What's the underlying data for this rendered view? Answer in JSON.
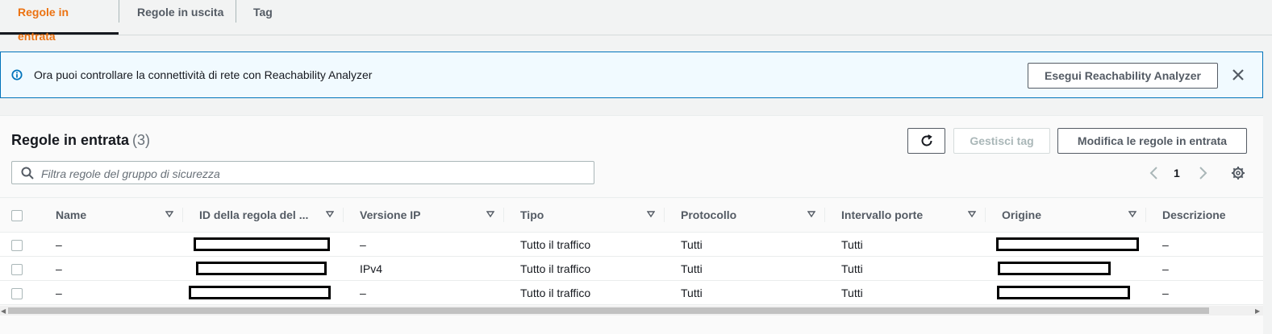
{
  "tabs": [
    {
      "label": "Regole in entrata",
      "active": true
    },
    {
      "label": "Regole in uscita",
      "active": false
    },
    {
      "label": "Tag",
      "active": false
    }
  ],
  "banner": {
    "icon": "info-icon",
    "text": "Ora puoi controllare la connettività di rete con Reachability Analyzer",
    "button_label": "Esegui Reachability Analyzer",
    "close_icon": "close-icon"
  },
  "panel": {
    "title": "Regole in entrata",
    "count": "(3)",
    "refresh_icon": "refresh-icon",
    "manage_tags_label": "Gestisci tag",
    "edit_rules_label": "Modifica le regole in entrata",
    "search_placeholder": "Filtra regole del gruppo di sicurezza",
    "page": "1"
  },
  "table": {
    "columns": [
      "Name",
      "ID della regola del ...",
      "Versione IP",
      "Tipo",
      "Protocollo",
      "Intervallo porte",
      "Origine",
      "Descrizione"
    ],
    "rows": [
      {
        "name": "–",
        "ip_version": "–",
        "type": "Tutto il traffico",
        "protocol": "Tutti",
        "port_range": "Tutti",
        "description": "–"
      },
      {
        "name": "–",
        "ip_version": "IPv4",
        "type": "Tutto il traffico",
        "protocol": "Tutti",
        "port_range": "Tutti",
        "description": "–"
      },
      {
        "name": "–",
        "ip_version": "–",
        "type": "Tutto il traffico",
        "protocol": "Tutti",
        "port_range": "Tutti",
        "description": "–"
      }
    ]
  },
  "colors": {
    "active_tab": "#ec7211",
    "info_border": "#0073bb",
    "info_bg": "#f1faff"
  }
}
